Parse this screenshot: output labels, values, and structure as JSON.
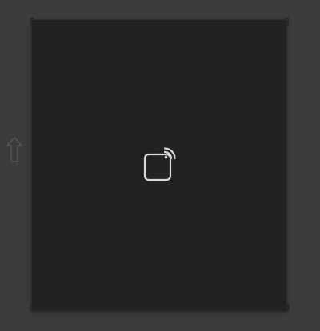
{
  "window": {
    "background": "#3c3c3c",
    "panel_background": "#222222",
    "icon_color": "#d8d8d8",
    "side_arrow_color": "#6a6a6a"
  },
  "media_panel": {
    "center_icon": "cast-icon",
    "nav_icon": "upload-arrow-icon"
  }
}
